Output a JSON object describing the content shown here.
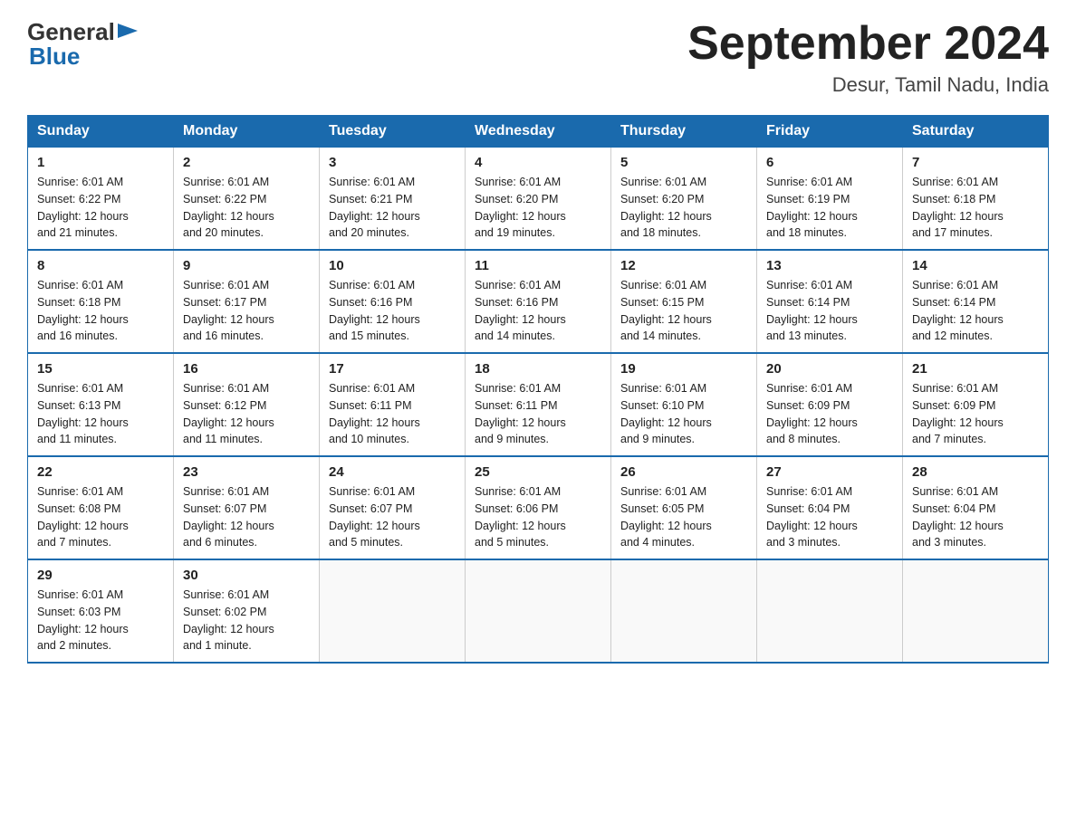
{
  "logo": {
    "general": "General",
    "blue": "Blue"
  },
  "title": "September 2024",
  "location": "Desur, Tamil Nadu, India",
  "days_of_week": [
    "Sunday",
    "Monday",
    "Tuesday",
    "Wednesday",
    "Thursday",
    "Friday",
    "Saturday"
  ],
  "weeks": [
    [
      {
        "day": "1",
        "sunrise": "6:01 AM",
        "sunset": "6:22 PM",
        "daylight": "12 hours and 21 minutes."
      },
      {
        "day": "2",
        "sunrise": "6:01 AM",
        "sunset": "6:22 PM",
        "daylight": "12 hours and 20 minutes."
      },
      {
        "day": "3",
        "sunrise": "6:01 AM",
        "sunset": "6:21 PM",
        "daylight": "12 hours and 20 minutes."
      },
      {
        "day": "4",
        "sunrise": "6:01 AM",
        "sunset": "6:20 PM",
        "daylight": "12 hours and 19 minutes."
      },
      {
        "day": "5",
        "sunrise": "6:01 AM",
        "sunset": "6:20 PM",
        "daylight": "12 hours and 18 minutes."
      },
      {
        "day": "6",
        "sunrise": "6:01 AM",
        "sunset": "6:19 PM",
        "daylight": "12 hours and 18 minutes."
      },
      {
        "day": "7",
        "sunrise": "6:01 AM",
        "sunset": "6:18 PM",
        "daylight": "12 hours and 17 minutes."
      }
    ],
    [
      {
        "day": "8",
        "sunrise": "6:01 AM",
        "sunset": "6:18 PM",
        "daylight": "12 hours and 16 minutes."
      },
      {
        "day": "9",
        "sunrise": "6:01 AM",
        "sunset": "6:17 PM",
        "daylight": "12 hours and 16 minutes."
      },
      {
        "day": "10",
        "sunrise": "6:01 AM",
        "sunset": "6:16 PM",
        "daylight": "12 hours and 15 minutes."
      },
      {
        "day": "11",
        "sunrise": "6:01 AM",
        "sunset": "6:16 PM",
        "daylight": "12 hours and 14 minutes."
      },
      {
        "day": "12",
        "sunrise": "6:01 AM",
        "sunset": "6:15 PM",
        "daylight": "12 hours and 14 minutes."
      },
      {
        "day": "13",
        "sunrise": "6:01 AM",
        "sunset": "6:14 PM",
        "daylight": "12 hours and 13 minutes."
      },
      {
        "day": "14",
        "sunrise": "6:01 AM",
        "sunset": "6:14 PM",
        "daylight": "12 hours and 12 minutes."
      }
    ],
    [
      {
        "day": "15",
        "sunrise": "6:01 AM",
        "sunset": "6:13 PM",
        "daylight": "12 hours and 11 minutes."
      },
      {
        "day": "16",
        "sunrise": "6:01 AM",
        "sunset": "6:12 PM",
        "daylight": "12 hours and 11 minutes."
      },
      {
        "day": "17",
        "sunrise": "6:01 AM",
        "sunset": "6:11 PM",
        "daylight": "12 hours and 10 minutes."
      },
      {
        "day": "18",
        "sunrise": "6:01 AM",
        "sunset": "6:11 PM",
        "daylight": "12 hours and 9 minutes."
      },
      {
        "day": "19",
        "sunrise": "6:01 AM",
        "sunset": "6:10 PM",
        "daylight": "12 hours and 9 minutes."
      },
      {
        "day": "20",
        "sunrise": "6:01 AM",
        "sunset": "6:09 PM",
        "daylight": "12 hours and 8 minutes."
      },
      {
        "day": "21",
        "sunrise": "6:01 AM",
        "sunset": "6:09 PM",
        "daylight": "12 hours and 7 minutes."
      }
    ],
    [
      {
        "day": "22",
        "sunrise": "6:01 AM",
        "sunset": "6:08 PM",
        "daylight": "12 hours and 7 minutes."
      },
      {
        "day": "23",
        "sunrise": "6:01 AM",
        "sunset": "6:07 PM",
        "daylight": "12 hours and 6 minutes."
      },
      {
        "day": "24",
        "sunrise": "6:01 AM",
        "sunset": "6:07 PM",
        "daylight": "12 hours and 5 minutes."
      },
      {
        "day": "25",
        "sunrise": "6:01 AM",
        "sunset": "6:06 PM",
        "daylight": "12 hours and 5 minutes."
      },
      {
        "day": "26",
        "sunrise": "6:01 AM",
        "sunset": "6:05 PM",
        "daylight": "12 hours and 4 minutes."
      },
      {
        "day": "27",
        "sunrise": "6:01 AM",
        "sunset": "6:04 PM",
        "daylight": "12 hours and 3 minutes."
      },
      {
        "day": "28",
        "sunrise": "6:01 AM",
        "sunset": "6:04 PM",
        "daylight": "12 hours and 3 minutes."
      }
    ],
    [
      {
        "day": "29",
        "sunrise": "6:01 AM",
        "sunset": "6:03 PM",
        "daylight": "12 hours and 2 minutes."
      },
      {
        "day": "30",
        "sunrise": "6:01 AM",
        "sunset": "6:02 PM",
        "daylight": "12 hours and 1 minute."
      },
      null,
      null,
      null,
      null,
      null
    ]
  ],
  "labels": {
    "sunrise": "Sunrise:",
    "sunset": "Sunset:",
    "daylight": "Daylight:"
  }
}
